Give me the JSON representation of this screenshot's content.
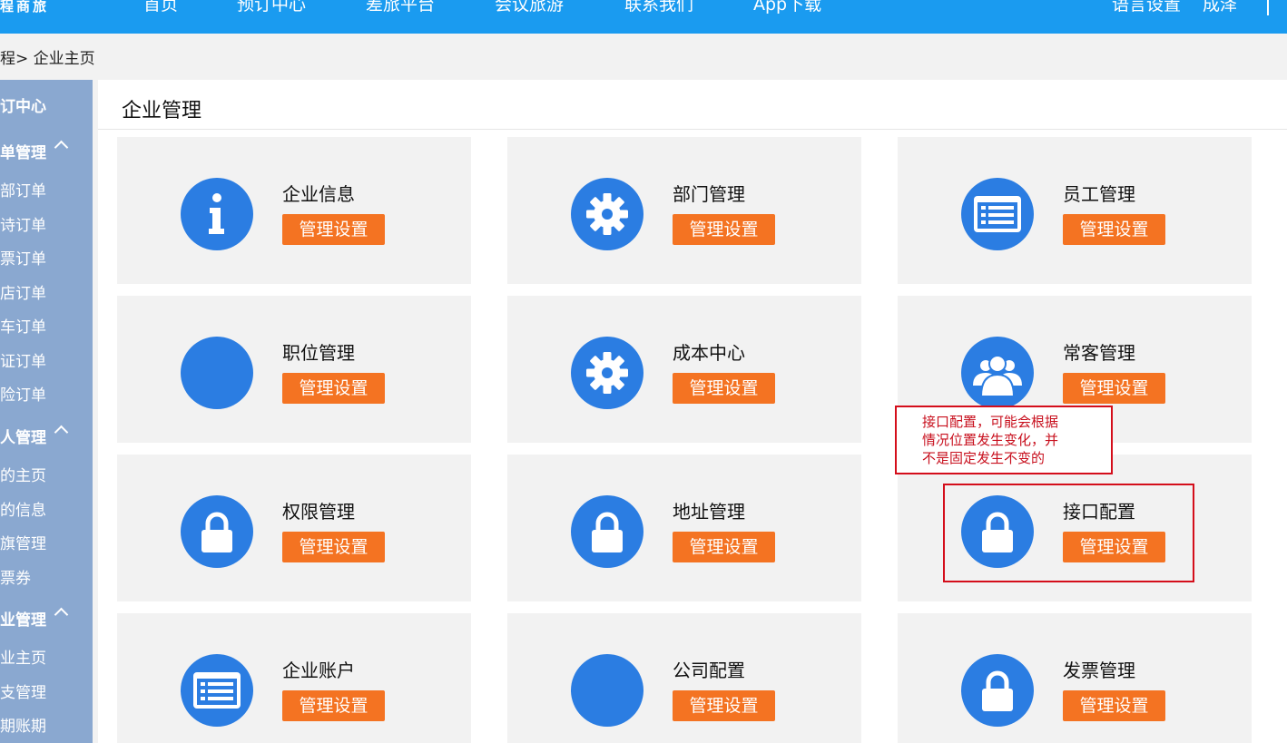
{
  "topnav": {
    "brand": "程商旅",
    "items": [
      "首页",
      "预订中心",
      "差旅平台",
      "会议旅游",
      "联系我们",
      "App下载"
    ],
    "language": "语言设置",
    "user": "成泽"
  },
  "breadcrumb": {
    "prev": "程>",
    "current": "企业主页"
  },
  "sidebar": {
    "booking_center": "订中心",
    "order_mgmt": {
      "label": "单管理",
      "items": [
        "部订单",
        "诗订单",
        "票订单",
        "店订单",
        "车订单",
        "证订单",
        "险订单"
      ]
    },
    "personal_mgmt": {
      "label": "人管理",
      "items": [
        "的主页",
        "的信息",
        "旗管理",
        "票券"
      ]
    },
    "corp_mgmt": {
      "label": "业管理",
      "items": [
        "业主页",
        "支管理",
        "期账期"
      ]
    }
  },
  "main": {
    "title": "企业管理",
    "button_label": "管理设置",
    "cards": [
      {
        "title": "企业信息",
        "icon": "info-icon"
      },
      {
        "title": "部门管理",
        "icon": "gear-icon"
      },
      {
        "title": "员工管理",
        "icon": "list-icon"
      },
      {
        "title": "职位管理",
        "icon": "blank-icon"
      },
      {
        "title": "成本中心",
        "icon": "gear-icon"
      },
      {
        "title": "常客管理",
        "icon": "users-icon"
      },
      {
        "title": "权限管理",
        "icon": "lock-icon"
      },
      {
        "title": "地址管理",
        "icon": "lock-icon"
      },
      {
        "title": "接口配置",
        "icon": "lock-icon"
      },
      {
        "title": "企业账户",
        "icon": "list-icon"
      },
      {
        "title": "公司配置",
        "icon": "blank-icon"
      },
      {
        "title": "发票管理",
        "icon": "lock-icon"
      }
    ]
  },
  "annotation": {
    "lines": [
      "接口配置，可能会根据",
      "情况位置发生变化，并",
      "不是固定发生不变的"
    ]
  },
  "colors": {
    "nav_bg": "#1a9bf0",
    "sidebar_bg": "#8aa8d0",
    "icon_blue": "#2b7de2",
    "button_orange": "#f47322",
    "annotation_red": "#d40e1b"
  }
}
